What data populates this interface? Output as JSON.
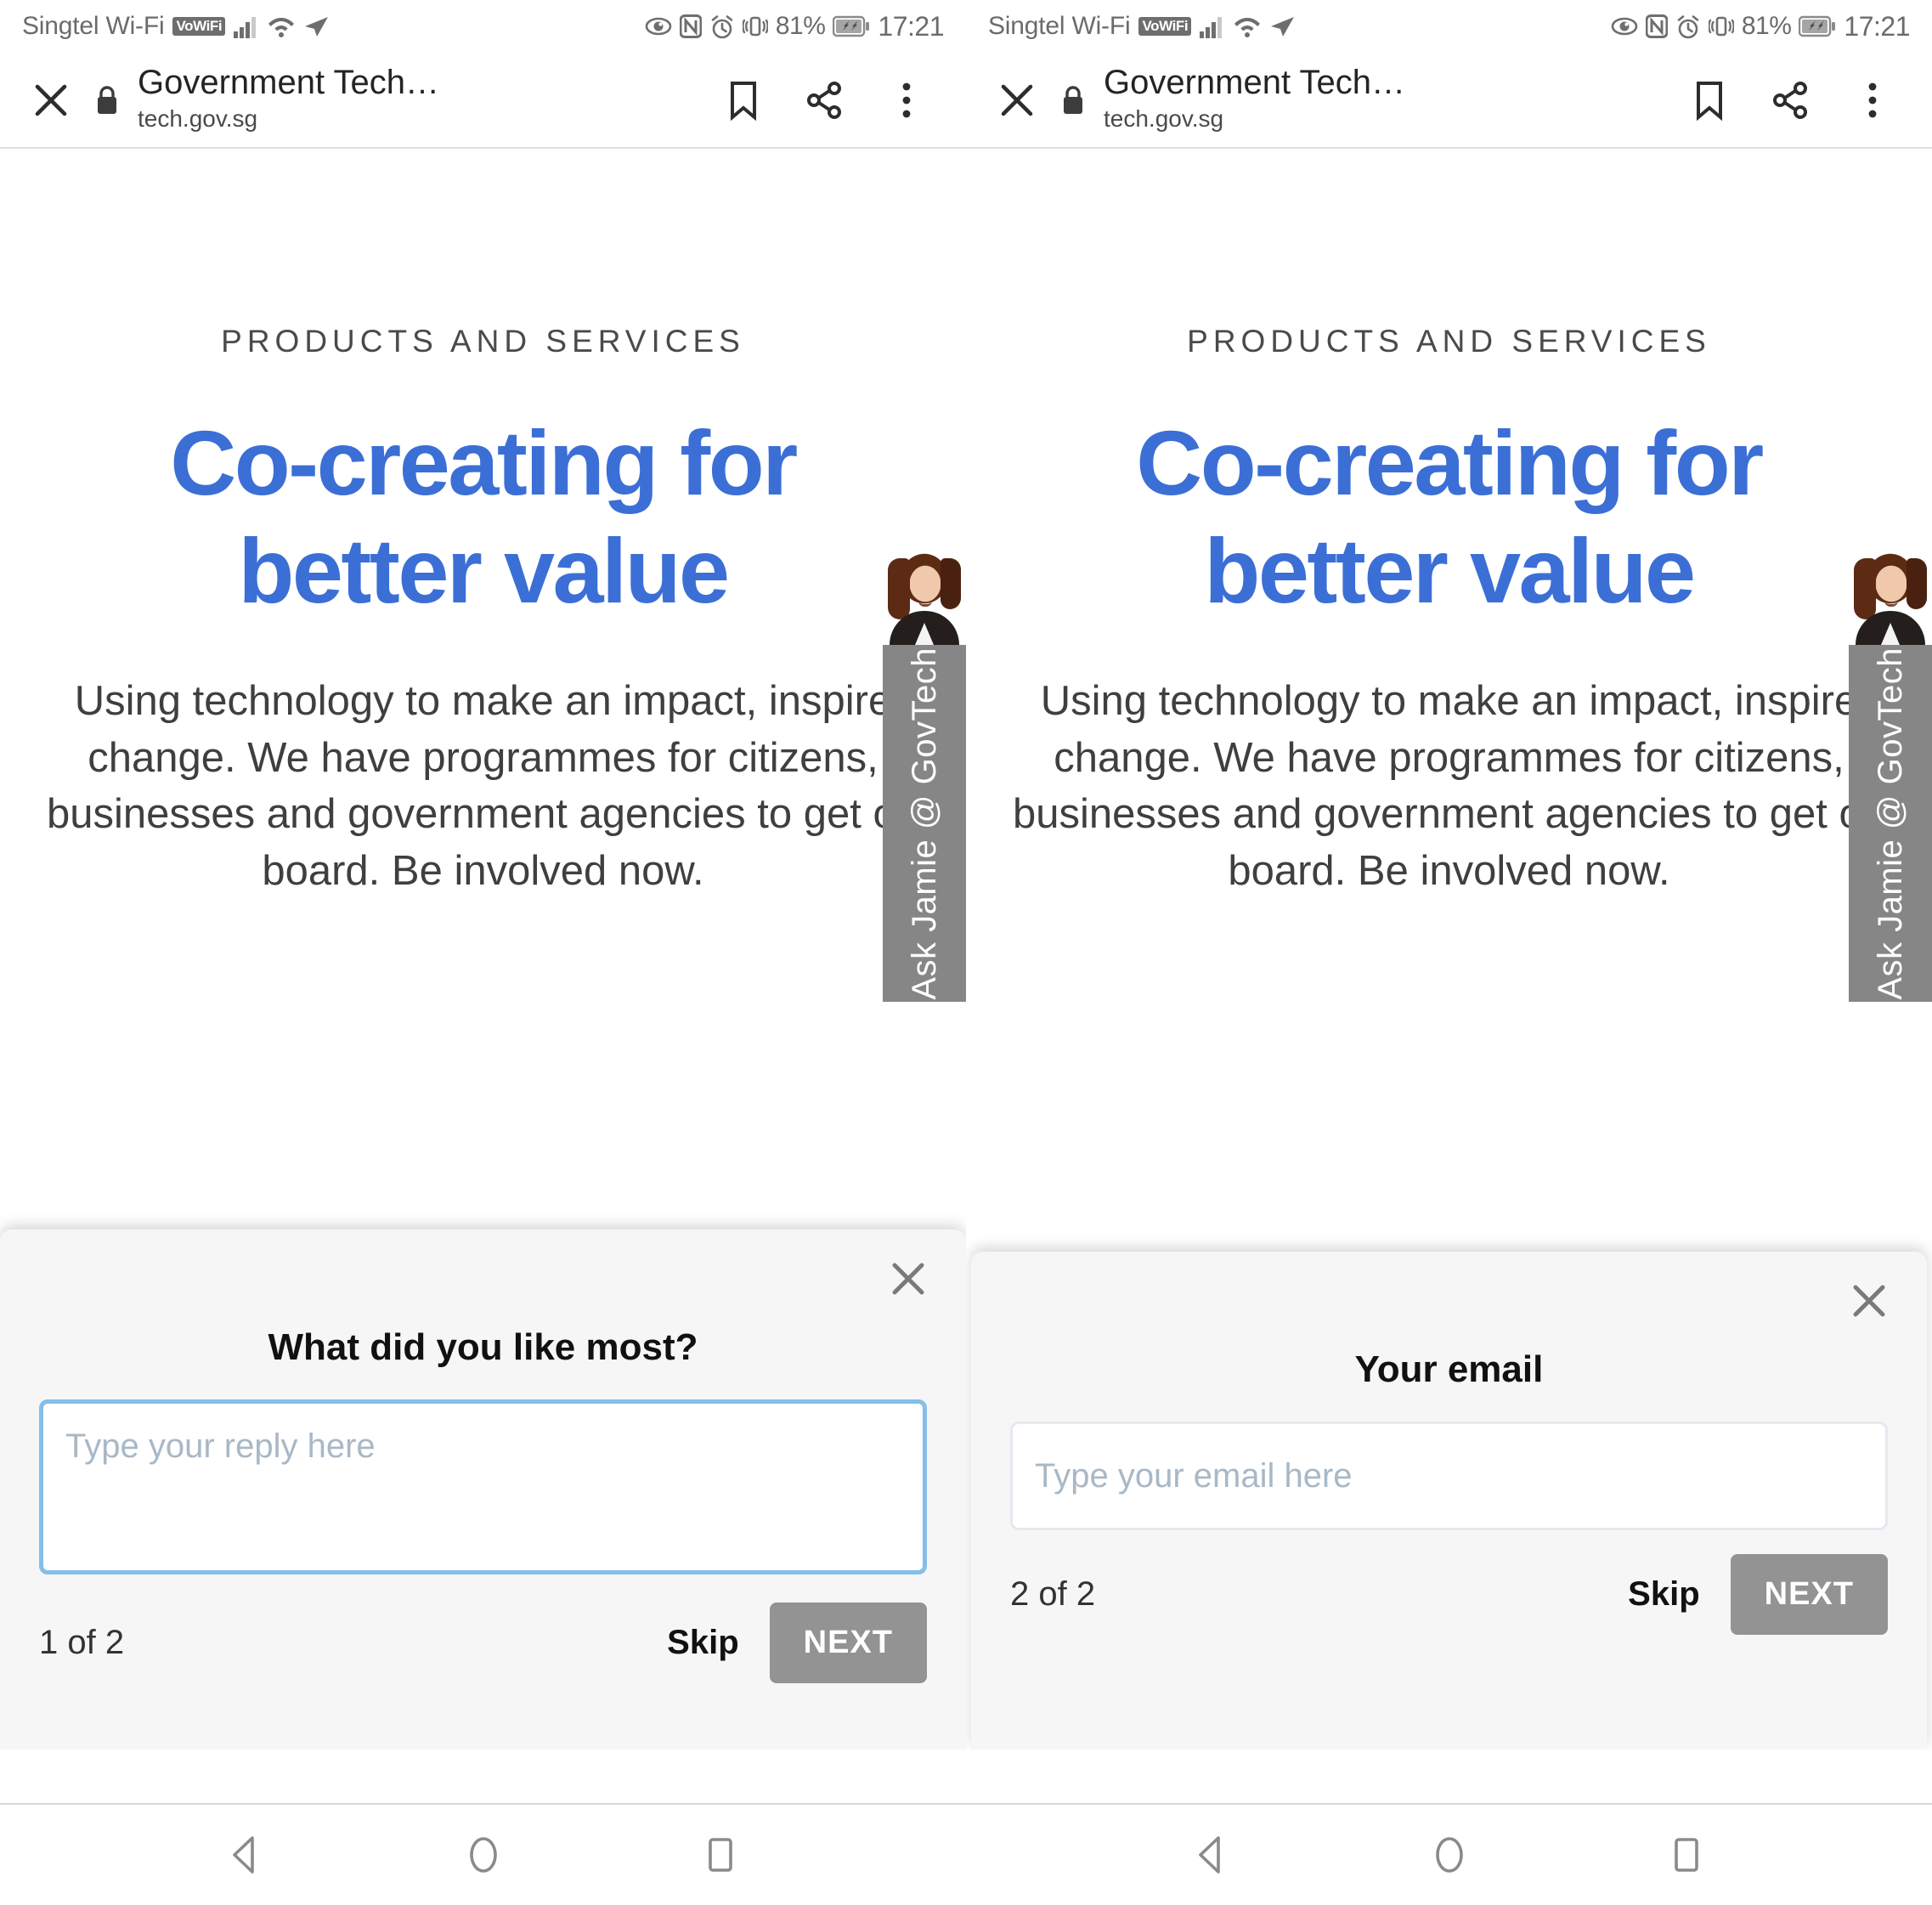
{
  "status_bar": {
    "carrier": "Singtel Wi-Fi",
    "vowifi_badge": "VoWiFi",
    "battery_percent": "81%",
    "time": "17:21",
    "icons": [
      "signal-bars-icon",
      "wifi-icon",
      "location-arrow-icon",
      "eye-comfort-icon",
      "nfc-icon",
      "alarm-clock-icon",
      "vibrate-icon",
      "battery-charging-icon"
    ]
  },
  "toolbar": {
    "close_label": "close-icon",
    "lock_label": "lock-icon",
    "title": "Government Tech…",
    "url": "tech.gov.sg",
    "bookmark_label": "bookmark-icon",
    "share_label": "share-icon",
    "menu_label": "overflow-menu-icon"
  },
  "page": {
    "eyebrow": "PRODUCTS AND SERVICES",
    "headline_line1": "Co-creating for",
    "headline_line2": "better value",
    "body": "Using technology to make an impact, inspire change. We have programmes for citizens, businesses and government agencies to get on board. Be involved now.",
    "headline_color": "#3b6fd6",
    "jamie_tab_label": "Ask Jamie @ GovTech"
  },
  "navbar": {
    "back_label": "back-icon",
    "home_label": "home-icon",
    "recents_label": "recents-icon"
  },
  "surveys": [
    {
      "question": "What did you like most?",
      "input_placeholder": "Type your reply here",
      "input_value": "",
      "counter": "1 of 2",
      "skip_label": "Skip",
      "next_label": "NEXT",
      "close_label": "close-icon"
    },
    {
      "question": "Your email",
      "input_placeholder": "Type your email here",
      "input_value": "",
      "counter": "2 of 2",
      "skip_label": "Skip",
      "next_label": "NEXT",
      "close_label": "close-icon"
    }
  ]
}
